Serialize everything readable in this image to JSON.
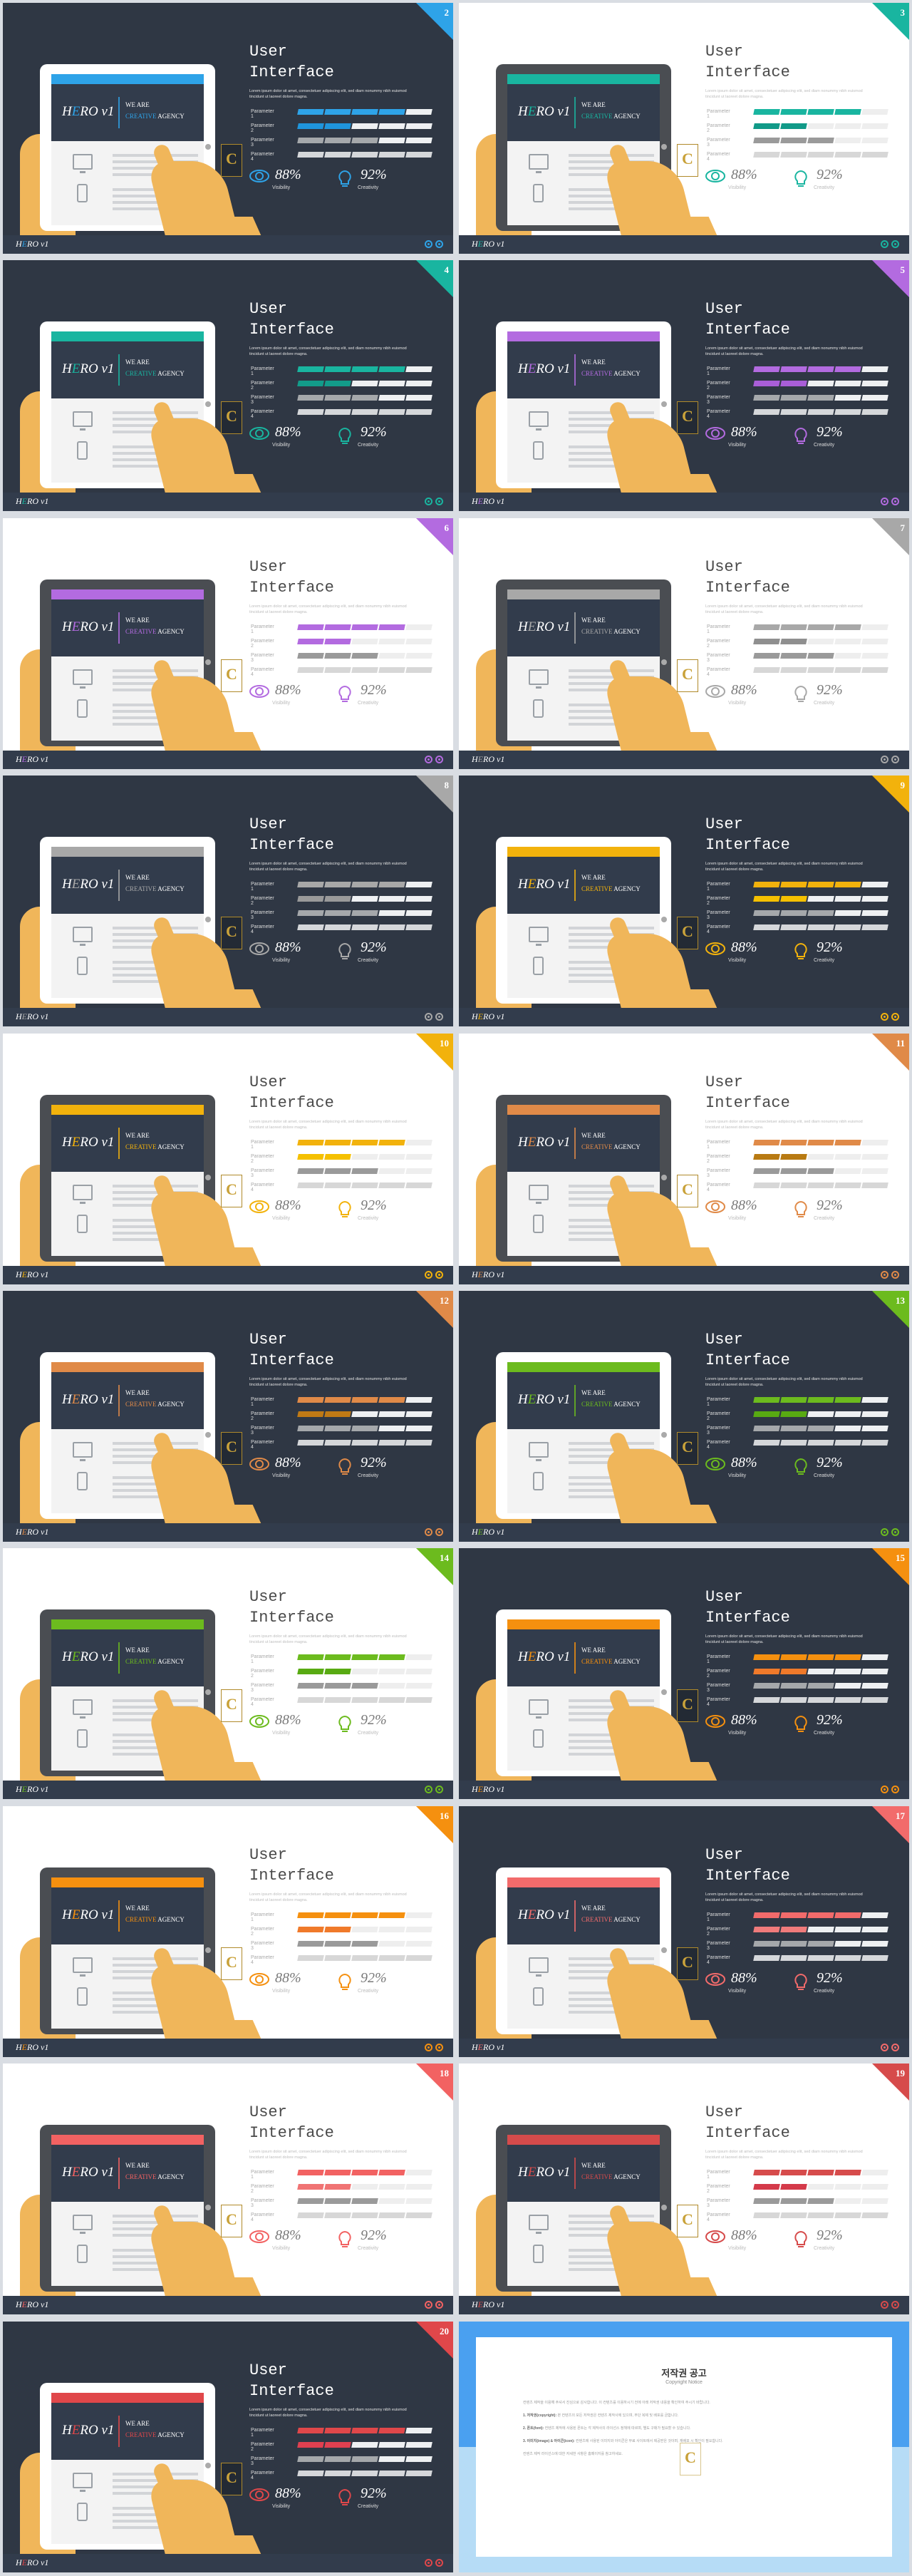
{
  "template": {
    "title_line1": "User",
    "title_line2": "Interface",
    "lorem": "Lorem ipsum dolor sit amet, consectetuer adipiscing elit, sed diam nonummy nibh euismod tincidunt ut laoreet dolore magna.",
    "hero_logo_h": "H",
    "hero_logo_e": "E",
    "hero_logo_rest": "RO v1",
    "hero_tag_line1": "WE ARE",
    "hero_tag_creative": "CREATIVE",
    "hero_tag_agency": " AGENCY",
    "footer_logo_h": "H",
    "footer_logo_e": "E",
    "footer_logo_rest": "RO v1",
    "badge_letter": "C",
    "parameters": [
      {
        "label": "Parameter 1",
        "filled_segments": 4,
        "total_segments": 5,
        "color_kind": "accent"
      },
      {
        "label": "Parameter 2",
        "filled_segments": 2,
        "total_segments": 5,
        "color_kind": "accent-dark"
      },
      {
        "label": "Parameter 3",
        "filled_segments": 3,
        "total_segments": 5,
        "color_kind": "gray"
      },
      {
        "label": "Parameter 4",
        "filled_segments": 5,
        "total_segments": 5,
        "color_kind": "light-gray"
      }
    ],
    "metrics": [
      {
        "icon": "eye-icon",
        "value": "88%",
        "label": "Visibility"
      },
      {
        "icon": "lightbulb-icon",
        "value": "92%",
        "label": "Creativity"
      }
    ]
  },
  "slides": [
    {
      "number": "2",
      "theme": "dark",
      "accent": "#2ea3e8",
      "accent_dark": "#1f95dc"
    },
    {
      "number": "3",
      "theme": "light",
      "accent": "#19b5a0",
      "accent_dark": "#119a88"
    },
    {
      "number": "4",
      "theme": "dark",
      "accent": "#19b5a0",
      "accent_dark": "#129c8a"
    },
    {
      "number": "5",
      "theme": "dark",
      "accent": "#b36be0",
      "accent_dark": "#a95ed8"
    },
    {
      "number": "6",
      "theme": "light",
      "accent": "#b36be0",
      "accent_dark": "#b36be0"
    },
    {
      "number": "7",
      "theme": "light",
      "accent": "#a8a8a8",
      "accent_dark": "#8f8f8f"
    },
    {
      "number": "8",
      "theme": "dark",
      "accent": "#a8a8a8",
      "accent_dark": "#9a9a9a"
    },
    {
      "number": "9",
      "theme": "dark",
      "accent": "#f2b20c",
      "accent_dark": "#f5c000"
    },
    {
      "number": "10",
      "theme": "light",
      "accent": "#f2b20c",
      "accent_dark": "#f5c000"
    },
    {
      "number": "11",
      "theme": "light",
      "accent": "#e08a48",
      "accent_dark": "#b87a12"
    },
    {
      "number": "12",
      "theme": "dark",
      "accent": "#e08a48",
      "accent_dark": "#c07a15"
    },
    {
      "number": "13",
      "theme": "dark",
      "accent": "#6cbb1e",
      "accent_dark": "#58aa12"
    },
    {
      "number": "14",
      "theme": "light",
      "accent": "#6cbb1e",
      "accent_dark": "#58aa12"
    },
    {
      "number": "15",
      "theme": "dark",
      "accent": "#f5900f",
      "accent_dark": "#f07a2a"
    },
    {
      "number": "16",
      "theme": "light",
      "accent": "#f5900f",
      "accent_dark": "#f07a2a"
    },
    {
      "number": "17",
      "theme": "dark",
      "accent": "#f26b6b",
      "accent_dark": "#f07b7b"
    },
    {
      "number": "18",
      "theme": "light",
      "accent": "#f26262",
      "accent_dark": "#f07474"
    },
    {
      "number": "19",
      "theme": "light",
      "accent": "#d64b4b",
      "accent_dark": "#d43a4a"
    },
    {
      "number": "20",
      "theme": "dark",
      "accent": "#e0474a",
      "accent_dark": "#e04050"
    }
  ],
  "copyright": {
    "title": "저작권 공고",
    "subtitle": "Copyright Notice",
    "paragraphs": [
      {
        "heading": "",
        "text": "컨텐츠 제작을 이용해 주셔서 진심으로 감사합니다. 이 컨텐츠를 이용하시기 전에 아래 저작권 내용을 확인하여 주시기 바랍니다."
      },
      {
        "heading": "1. 저작권(copyright):",
        "text": "본 컨텐츠의 모든 저작권은 컨텐츠 제작사에 있으며, 무단 복제 및 배포를 금합니다."
      },
      {
        "heading": "2. 폰트(font):",
        "text": "컨텐츠 제작에 사용된 폰트는 각 제작사의 라이선스 정책에 따르며, 별도 구매가 필요할 수 있습니다."
      },
      {
        "heading": "3. 이미지(image) & 아이콘(icon):",
        "text": "컨텐츠에 사용된 이미지와 아이콘은 무료 사이트에서 제공받은 것이며, 재배포 시 확인이 필요합니다."
      },
      {
        "heading": "",
        "text": "컨텐츠 제작 라이선스에 대한 자세한 사항은 홈페이지를 참고하세요."
      }
    ],
    "badge_letter": "C"
  }
}
